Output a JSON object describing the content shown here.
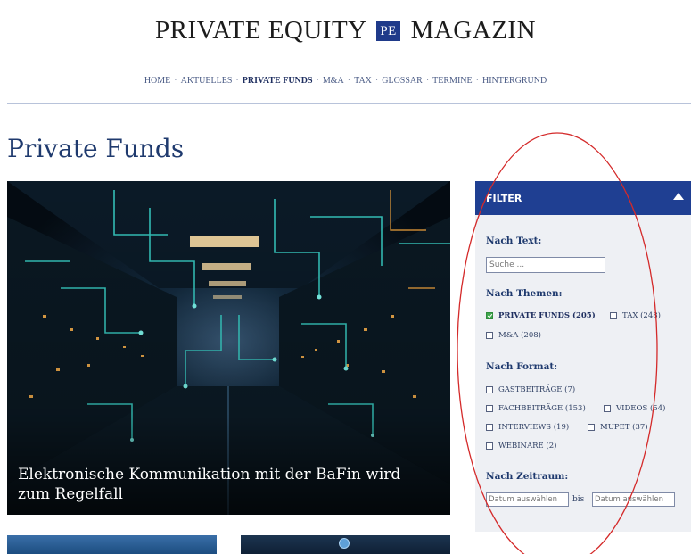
{
  "header": {
    "logo_left": "PRIVATE EQUITY",
    "logo_badge": "PE",
    "logo_right": "MAGAZIN"
  },
  "nav": {
    "items": [
      "HOME",
      "AKTUELLES",
      "PRIVATE FUNDS",
      "M&A",
      "TAX",
      "GLOSSAR",
      "TERMINE",
      "HINTERGRUND"
    ],
    "active": "PRIVATE FUNDS",
    "separator": "·"
  },
  "page": {
    "title": "Private Funds"
  },
  "hero": {
    "title": "Elektronische Kommunikation mit der BaFin wird zum Regelfall"
  },
  "filter": {
    "header": "FILTER",
    "text_section": "Nach Text:",
    "search_placeholder": "Suche ...",
    "themes_section": "Nach Themen:",
    "themes": [
      {
        "label": "PRIVATE FUNDS (205)",
        "checked": true
      },
      {
        "label": "TAX (248)",
        "checked": false
      },
      {
        "label": "M&A (208)",
        "checked": false
      }
    ],
    "format_section": "Nach Format:",
    "formats": [
      {
        "label": "GASTBEITRÄGE (7)",
        "checked": false
      },
      {
        "label": "FACHBEITRÄGE (153)",
        "checked": false
      },
      {
        "label": "VIDEOS (54)",
        "checked": false
      },
      {
        "label": "INTERVIEWS (19)",
        "checked": false
      },
      {
        "label": "MUPET (37)",
        "checked": false
      },
      {
        "label": "WEBINARE (2)",
        "checked": false
      }
    ],
    "period_section": "Nach Zeitraum:",
    "date_from_placeholder": "Datum auswählen",
    "bis": "bis",
    "date_to_placeholder": "Datum auswählen"
  },
  "colors": {
    "brand_blue": "#1f3f92",
    "title_blue": "#1f3a6e",
    "filter_bg": "#eef0f4",
    "checkbox_green": "#3fa64c",
    "annotation_red": "#d42a2a"
  }
}
